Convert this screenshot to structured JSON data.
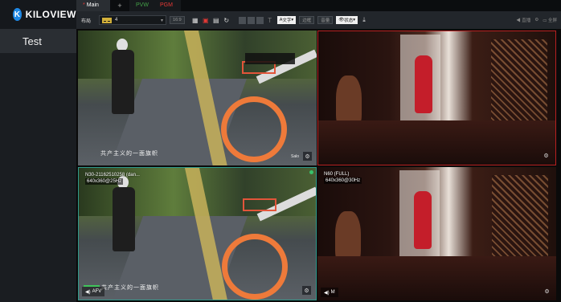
{
  "brand": {
    "logo_text": "KILOVIEW"
  },
  "tabs": [
    {
      "label": "Main",
      "modified_marker": "*"
    },
    {
      "label": "+"
    },
    {
      "label": "PVW"
    },
    {
      "label": "PGM"
    }
  ],
  "toolbar": {
    "layout_label": "布局",
    "layout_value": "4",
    "ratio_value": "16:9",
    "text_button": "文字",
    "border_button": "边框",
    "audio_button": "音量",
    "status_button": "状态",
    "direct_label": "直播",
    "fullscreen_label": "全屏"
  },
  "sidebar": {
    "items": [
      {
        "label": "Test"
      }
    ]
  },
  "cells": [
    {
      "name": "",
      "resolution": "",
      "tag": "Salo",
      "subtitle": "共产主义的一面旗帜"
    },
    {
      "name": "",
      "resolution": ""
    },
    {
      "name": "N30-21162510258 (dan...",
      "resolution": "640x360@25Hz",
      "audio": "AFV",
      "subtitle": "共产主义的一面旗帜"
    },
    {
      "name": "N60 (FULL)",
      "resolution": "640x360@30Hz",
      "audio": "M"
    }
  ],
  "colors": {
    "pvw": "#43a047",
    "pgm": "#e53935",
    "accent": "#1e88e5",
    "pgm_border": "#b82020",
    "pvw_border": "#2f9a8c"
  },
  "icons": [
    "gear-icon",
    "save-icon",
    "refresh-icon",
    "eye-icon",
    "speaker-icon"
  ]
}
